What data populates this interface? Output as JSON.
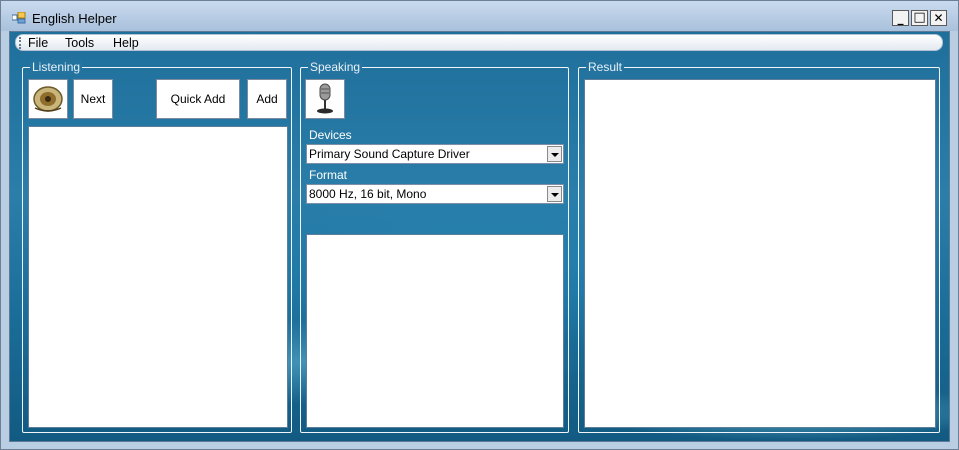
{
  "window": {
    "title": "English Helper"
  },
  "title_buttons": {
    "minimize": "_",
    "maximize": "□",
    "close": "✕"
  },
  "menu": {
    "items": [
      "File",
      "Tools",
      "Help"
    ]
  },
  "listening": {
    "legend": "Listening",
    "speaker_icon": "speaker-icon",
    "next_label": "Next",
    "quick_add_label": "Quick Add",
    "add_label": "Add"
  },
  "speaking": {
    "legend": "Speaking",
    "mic_icon": "microphone-icon",
    "devices_label": "Devices",
    "devices_value": "Primary Sound Capture Driver",
    "format_label": "Format",
    "format_value": "8000 Hz, 16 bit, Mono"
  },
  "result": {
    "legend": "Result"
  }
}
